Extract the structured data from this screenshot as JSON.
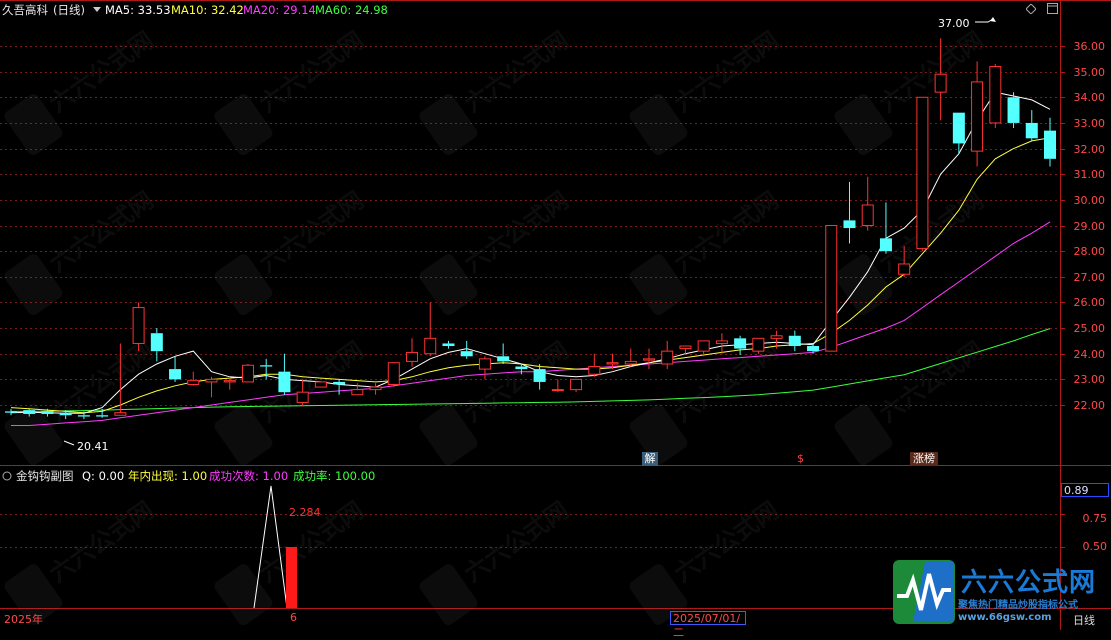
{
  "header": {
    "stock_name": "久吾高科",
    "period_tag": "(日线)",
    "ma5_label": "MA5: 33.53",
    "ma10_label": "MA10: 32.42",
    "ma20_label": "MA20: 29.14",
    "ma60_label": "MA60: 24.98",
    "colors": {
      "ma5": "#ffffff",
      "ma10": "#ffff3a",
      "ma20": "#ff3cff",
      "ma60": "#3cff3c"
    }
  },
  "price_axis": [
    "36.00",
    "35.00",
    "34.00",
    "33.00",
    "32.00",
    "31.00",
    "30.00",
    "29.00",
    "28.00",
    "27.00",
    "26.00",
    "25.00",
    "24.00",
    "23.00",
    "22.00"
  ],
  "annotations": {
    "high": "37.00",
    "low": "20.41"
  },
  "markers": {
    "jie": "解",
    "s": "$",
    "zhangbang": "涨榜"
  },
  "sub_header": {
    "name": "金钩钩副图",
    "q": "Q: 0.00",
    "nian_nei": "年内出现: 1.00",
    "cheng_gong_ci_shu": "成功次数: 1.00",
    "cheng_gong_lv": "成功率: 100.00"
  },
  "sub_axis": [
    "0.75",
    "0.50"
  ],
  "sub_value": "0.89",
  "sub_peak": "2.284",
  "bottom": {
    "year": "2025年",
    "six": "6",
    "date": "2025/07/01/二",
    "period": "日线"
  },
  "logo": {
    "brand": "六六公式网",
    "tagline": "聚焦热门精品炒股指标公式",
    "url": "www.66gsw.com"
  },
  "chart_data": {
    "type": "candlestick",
    "ylim": [
      21.2,
      36.8
    ],
    "candles": [
      [
        21.75,
        21.85,
        21.7,
        21.6
      ],
      [
        21.8,
        21.85,
        21.65,
        21.55
      ],
      [
        21.75,
        21.85,
        21.65,
        21.55
      ],
      [
        21.7,
        21.8,
        21.6,
        21.45
      ],
      [
        21.6,
        21.75,
        21.55,
        21.45
      ],
      [
        21.6,
        21.85,
        21.55,
        21.5
      ],
      [
        21.6,
        24.4,
        21.7,
        21.6
      ],
      [
        24.4,
        26.0,
        25.8,
        24.1
      ],
      [
        24.8,
        25.0,
        24.1,
        23.7
      ],
      [
        23.4,
        23.9,
        23.0,
        22.9
      ],
      [
        22.8,
        23.3,
        22.95,
        22.75
      ],
      [
        22.9,
        23.1,
        23.0,
        22.3
      ],
      [
        22.9,
        23.1,
        22.95,
        22.6
      ],
      [
        22.9,
        23.6,
        23.55,
        22.9
      ],
      [
        23.55,
        23.8,
        23.5,
        23.0
      ],
      [
        23.3,
        24.0,
        22.5,
        22.4
      ],
      [
        22.1,
        23.0,
        22.5,
        21.95
      ],
      [
        22.7,
        22.85,
        22.9,
        22.75
      ],
      [
        22.9,
        23.0,
        22.8,
        22.4
      ],
      [
        22.4,
        22.85,
        22.6,
        22.4
      ],
      [
        22.6,
        22.85,
        22.7,
        22.4
      ],
      [
        22.8,
        23.5,
        23.65,
        22.7
      ],
      [
        23.7,
        24.6,
        24.05,
        23.5
      ],
      [
        24.0,
        26.0,
        24.6,
        23.9
      ],
      [
        24.4,
        24.5,
        24.3,
        24.2
      ],
      [
        24.1,
        24.5,
        23.9,
        23.8
      ],
      [
        23.4,
        23.9,
        23.8,
        23.0
      ],
      [
        23.9,
        24.4,
        23.7,
        23.6
      ],
      [
        23.5,
        23.6,
        23.4,
        23.2
      ],
      [
        23.4,
        23.6,
        22.9,
        22.6
      ],
      [
        22.6,
        23.0,
        22.6,
        22.5
      ],
      [
        22.6,
        23.0,
        23.0,
        22.5
      ],
      [
        23.2,
        24.0,
        23.5,
        23.1
      ],
      [
        23.6,
        24.0,
        23.65,
        23.4
      ],
      [
        23.6,
        24.2,
        23.7,
        23.5
      ],
      [
        23.75,
        24.2,
        23.8,
        23.4
      ],
      [
        23.6,
        24.5,
        24.1,
        23.4
      ],
      [
        24.2,
        24.3,
        24.3,
        24.0
      ],
      [
        24.1,
        24.5,
        24.5,
        23.9
      ],
      [
        24.4,
        24.8,
        24.5,
        24.0
      ],
      [
        24.6,
        24.7,
        24.2,
        23.95
      ],
      [
        24.1,
        24.4,
        24.6,
        24.0
      ],
      [
        24.6,
        24.9,
        24.7,
        24.2
      ],
      [
        24.7,
        24.9,
        24.3,
        24.1
      ],
      [
        24.3,
        24.4,
        24.1,
        24.0
      ],
      [
        24.1,
        29.0,
        29.0,
        24.1
      ],
      [
        29.2,
        30.7,
        28.9,
        28.3
      ],
      [
        29.0,
        30.9,
        29.8,
        28.8
      ],
      [
        28.5,
        29.9,
        28.0,
        27.9
      ],
      [
        27.1,
        28.2,
        27.5,
        27.0
      ],
      [
        28.1,
        34.0,
        34.0,
        28.0
      ],
      [
        34.2,
        36.3,
        34.9,
        33.1
      ],
      [
        33.4,
        33.4,
        32.2,
        31.8
      ],
      [
        31.9,
        35.4,
        34.6,
        31.3
      ],
      [
        33.0,
        35.3,
        35.2,
        32.8
      ],
      [
        34.0,
        34.2,
        33.0,
        32.8
      ],
      [
        33.0,
        33.5,
        32.4,
        32.3
      ],
      [
        32.7,
        33.2,
        31.6,
        31.3
      ]
    ],
    "ma5": [
      21.7,
      21.72,
      21.7,
      21.68,
      21.68,
      21.9,
      22.6,
      23.2,
      23.6,
      23.9,
      24.1,
      23.3,
      23.1,
      23.05,
      23.15,
      23.0,
      22.95,
      22.9,
      22.8,
      22.75,
      22.7,
      23.0,
      23.4,
      23.8,
      24.05,
      24.2,
      24.0,
      23.8,
      23.6,
      23.3,
      23.15,
      23.1,
      23.15,
      23.3,
      23.5,
      23.65,
      23.8,
      24.0,
      24.15,
      24.3,
      24.35,
      24.4,
      24.45,
      24.4,
      24.35,
      25.3,
      26.2,
      27.2,
      28.5,
      28.9,
      29.6,
      31.0,
      31.8,
      33.1,
      34.2,
      34.05,
      33.9,
      33.53
    ],
    "ma10": [
      21.9,
      21.85,
      21.8,
      21.75,
      21.7,
      21.75,
      22.0,
      22.3,
      22.55,
      22.75,
      22.9,
      23.0,
      23.05,
      23.1,
      23.2,
      23.2,
      23.1,
      23.05,
      23.0,
      22.95,
      22.9,
      22.95,
      23.1,
      23.3,
      23.45,
      23.55,
      23.6,
      23.65,
      23.6,
      23.5,
      23.45,
      23.4,
      23.4,
      23.45,
      23.55,
      23.65,
      23.75,
      23.85,
      23.95,
      24.05,
      24.15,
      24.2,
      24.3,
      24.35,
      24.4,
      24.8,
      25.3,
      25.9,
      26.6,
      27.1,
      27.9,
      28.7,
      29.6,
      30.8,
      31.6,
      32.0,
      32.3,
      32.42
    ],
    "ma20": [
      21.2,
      21.2,
      21.25,
      21.3,
      21.35,
      21.4,
      21.5,
      21.6,
      21.7,
      21.8,
      21.9,
      22.0,
      22.1,
      22.2,
      22.3,
      22.4,
      22.45,
      22.5,
      22.55,
      22.6,
      22.65,
      22.75,
      22.85,
      22.95,
      23.05,
      23.15,
      23.2,
      23.25,
      23.3,
      23.3,
      23.35,
      23.4,
      23.45,
      23.5,
      23.55,
      23.6,
      23.65,
      23.7,
      23.75,
      23.8,
      23.85,
      23.9,
      23.95,
      24.0,
      24.05,
      24.25,
      24.5,
      24.75,
      25.0,
      25.3,
      25.8,
      26.3,
      26.8,
      27.3,
      27.8,
      28.3,
      28.7,
      29.14
    ],
    "ma60": [
      21.75,
      21.75,
      21.76,
      21.77,
      21.78,
      21.8,
      21.82,
      21.84,
      21.86,
      21.88,
      21.9,
      21.92,
      21.93,
      21.94,
      21.95,
      21.96,
      21.97,
      21.98,
      21.99,
      22.0,
      22.01,
      22.02,
      22.03,
      22.04,
      22.05,
      22.06,
      22.07,
      22.08,
      22.09,
      22.1,
      22.11,
      22.12,
      22.14,
      22.16,
      22.18,
      22.2,
      22.23,
      22.26,
      22.29,
      22.32,
      22.36,
      22.4,
      22.46,
      22.52,
      22.58,
      22.7,
      22.82,
      22.94,
      23.06,
      23.18,
      23.4,
      23.62,
      23.84,
      24.06,
      24.28,
      24.5,
      24.75,
      24.98
    ]
  }
}
